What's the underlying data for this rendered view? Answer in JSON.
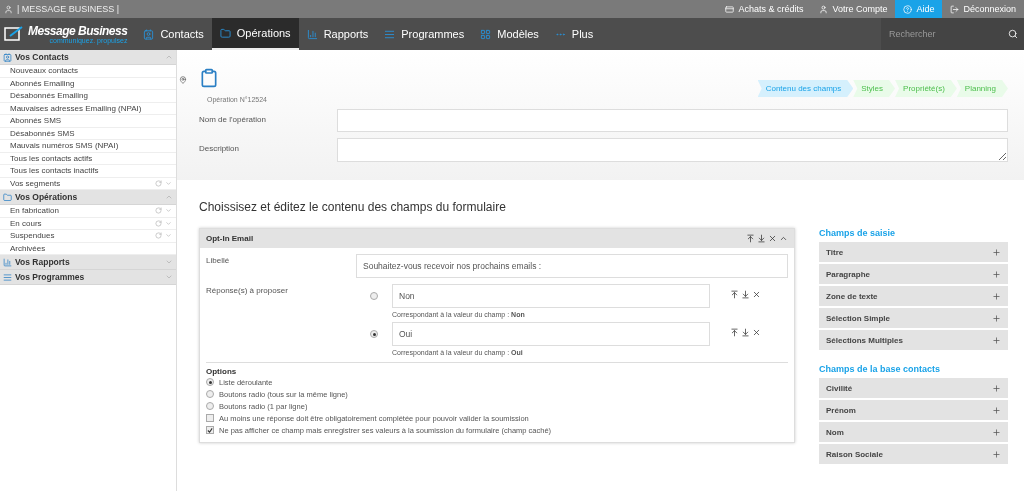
{
  "topbar": {
    "brand": "| MESSAGE BUSINESS |",
    "links": [
      {
        "label": "Achats & crédits",
        "selected": false
      },
      {
        "label": "Votre Compte",
        "selected": false
      },
      {
        "label": "Aide",
        "selected": true
      },
      {
        "label": "Déconnexion",
        "selected": false
      }
    ]
  },
  "nav": {
    "logo": "Message Business",
    "tagline": "communiquez. propulsez",
    "items": [
      {
        "label": "Contacts",
        "selected": false
      },
      {
        "label": "Opérations",
        "selected": true
      },
      {
        "label": "Rapports",
        "selected": false
      },
      {
        "label": "Programmes",
        "selected": false
      },
      {
        "label": "Modèles",
        "selected": false
      },
      {
        "label": "Plus",
        "selected": false
      }
    ],
    "search": {
      "placeholder": "Rechercher"
    }
  },
  "sidebar": [
    {
      "title": "Vos Contacts",
      "expanded": true,
      "items": [
        {
          "label": "Nouveaux contacts",
          "actions": false
        },
        {
          "label": "Abonnés Emailing",
          "actions": false
        },
        {
          "label": "Désabonnés Emailing",
          "actions": false
        },
        {
          "label": "Mauvaises adresses Emailing (NPAI)",
          "actions": false
        },
        {
          "label": "Abonnés SMS",
          "actions": false
        },
        {
          "label": "Désabonnés SMS",
          "actions": false
        },
        {
          "label": "Mauvais numéros SMS (NPAI)",
          "actions": false
        },
        {
          "label": "Tous les contacts actifs",
          "actions": false
        },
        {
          "label": "Tous les contacts inactifs",
          "actions": false
        },
        {
          "label": "Vos segments",
          "actions": true
        }
      ]
    },
    {
      "title": "Vos Opérations",
      "expanded": true,
      "items": [
        {
          "label": "En fabrication",
          "actions": true
        },
        {
          "label": "En cours",
          "actions": true
        },
        {
          "label": "Suspendues",
          "actions": true
        },
        {
          "label": "Archivées",
          "actions": false
        }
      ]
    },
    {
      "title": "Vos Rapports",
      "expanded": false
    },
    {
      "title": "Vos Programmes",
      "expanded": false
    }
  ],
  "operation": {
    "number": "Opération N°12524",
    "steps": [
      {
        "label": "Contenu des champs",
        "selected": true
      },
      {
        "label": "Styles",
        "selected": false
      },
      {
        "label": "Propriété(s)",
        "selected": false
      },
      {
        "label": "Planning",
        "selected": false
      }
    ],
    "fields": [
      {
        "label": "Nom de l'opération",
        "kind": "input"
      },
      {
        "label": "Description",
        "kind": "textarea"
      }
    ]
  },
  "editor": {
    "heading": "Choissisez et éditez le contenu des champs du formulaire",
    "card": {
      "title": "Opt-In Email",
      "label_caption": "Libellé",
      "label_value": "Souhaitez-vous recevoir nos prochains emails :",
      "answers_caption": "Réponse(s) à proposer",
      "answers": [
        {
          "value": "Non",
          "note": "Correspondant à la valeur du champ : ",
          "note_value": "Non",
          "selected": false
        },
        {
          "value": "Oui",
          "note": "Correspondant à la valeur du champ : ",
          "note_value": "Oui",
          "selected": true
        }
      ],
      "options_title": "Options",
      "display": [
        {
          "label": "Liste déroulante",
          "selected": true
        },
        {
          "label": "Boutons radio (tous sur la même ligne)",
          "selected": false
        },
        {
          "label": "Boutons radio (1 par ligne)",
          "selected": false
        }
      ],
      "checks": [
        {
          "label": "Au moins une réponse doit être obligatoirement complétée pour pouvoir valider la soumission",
          "checked": false
        },
        {
          "label": "Ne pas afficher ce champ mais enregistrer ses valeurs à la soumission du formulaire (champ caché)",
          "checked": true
        }
      ]
    }
  },
  "palette": [
    {
      "title": "Champs de saisie",
      "items": [
        "Titre",
        "Paragraphe",
        "Zone de texte",
        "Sélection Simple",
        "Sélections Multiples"
      ]
    },
    {
      "title": "Champs de la base contacts",
      "items": [
        "Civilité",
        "Prénom",
        "Nom",
        "Raison Sociale"
      ]
    }
  ]
}
